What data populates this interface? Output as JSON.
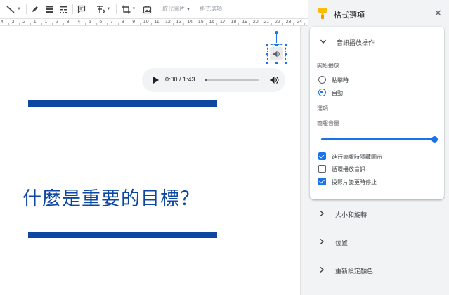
{
  "toolbar": {
    "replace_image": "取代圖片",
    "format_options": "格式選項"
  },
  "ruler": {
    "ticks": [
      "4",
      "3",
      "2",
      "1",
      "1",
      "2",
      "3",
      "4",
      "5",
      "6",
      "7",
      "8",
      "9",
      "10",
      "11",
      "12",
      "13",
      "14",
      "15",
      "16",
      "17",
      "18",
      "19",
      "20",
      "21",
      "22",
      "23",
      "24"
    ]
  },
  "slide": {
    "title": "什麼是重要的目標？"
  },
  "player": {
    "time": "0:00 / 1:43"
  },
  "sidebar": {
    "title": "格式選項",
    "audio_section": {
      "title": "音訊播放操作",
      "start_label": "開始播放",
      "options": [
        "點擊時",
        "自動"
      ],
      "selected": "自動",
      "options_label": "選項",
      "volume_label": "簡報音量",
      "volume_level": 1.0,
      "checkboxes": [
        {
          "label": "進行簡報時隱藏圖示",
          "checked": true
        },
        {
          "label": "循環播放音訊",
          "checked": false
        },
        {
          "label": "投影片變更時停止",
          "checked": true
        }
      ]
    },
    "sections": [
      "大小和旋轉",
      "位置",
      "重新設定顏色"
    ]
  },
  "colors": {
    "accent": "#1a73e8",
    "slide_blue": "#0d47a1"
  }
}
